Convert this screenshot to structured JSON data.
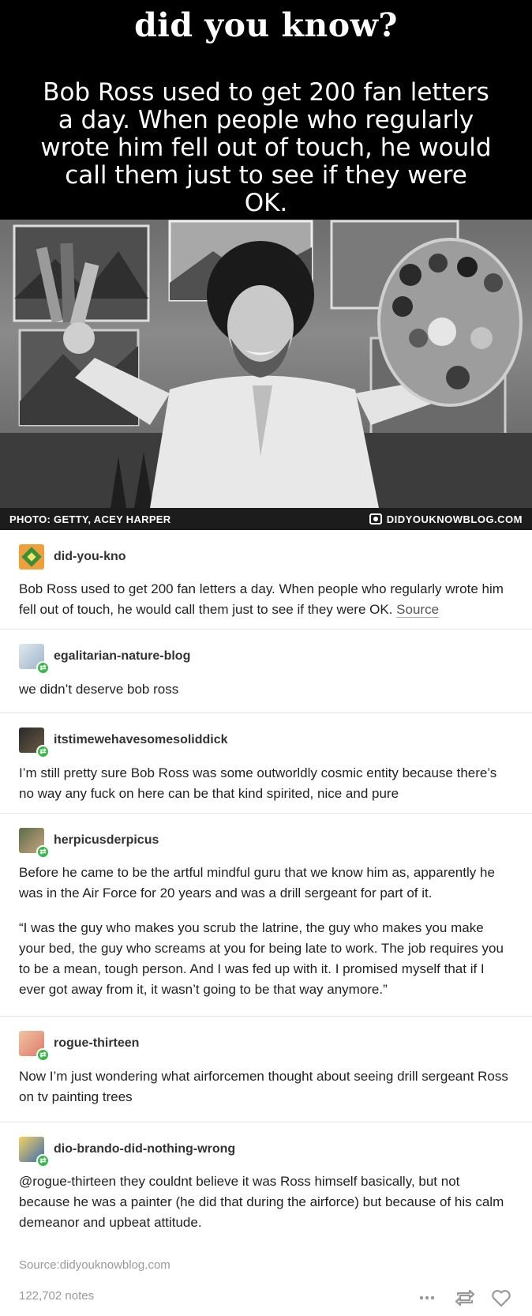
{
  "header": {
    "title": "did you know?",
    "fact": "Bob Ross used to get 200 fan letters a day. When people who regularly wrote him fell out of touch, he would call them just to see if they were OK."
  },
  "photo": {
    "credit": "PHOTO: GETTY, ACEY HARPER",
    "blog": "DIDYOUKNOWBLOG.COM"
  },
  "posts": [
    {
      "username": "did-you-kno",
      "icon": "did-you-know-logo-icon",
      "paragraphs": [
        "Bob Ross used to get 200 fan letters a day. When people who regularly wrote him fell out of touch, he would call them just to see if they were OK."
      ],
      "link": "Source"
    },
    {
      "username": "egalitarian-nature-blog",
      "paragraphs": [
        "we didn’t deserve bob ross"
      ]
    },
    {
      "username": "itstimewehavesomesoliddick",
      "paragraphs": [
        "I’m still pretty sure Bob Ross was some outworldly cosmic entity because there’s no way any fuck on here can be that kind spirited, nice and pure"
      ]
    },
    {
      "username": "herpicusderpicus",
      "paragraphs": [
        "Before he came to be the artful mindful guru that we know him as, apparently he was in the Air Force for 20 years and was a drill sergeant for part of it.",
        "“I was the guy who makes you scrub the latrine, the guy who makes you make your bed, the guy who screams at you for being late to work. The job requires you to be a mean, tough person. And I was fed up with it. I promised myself that if I ever got away from it, it wasn’t going to be that way anymore.”"
      ]
    },
    {
      "username": "rogue-thirteen",
      "paragraphs": [
        "Now I’m just wondering what airforcemen thought about seeing drill sergeant Ross on tv painting trees"
      ]
    },
    {
      "username": "dio-brando-did-nothing-wrong",
      "paragraphs": [
        "@rogue-thirteen they couldnt believe it was Ross himself basically, but not because he was a painter (he did that during the airforce) but because of his calm demeanor and upbeat attitude."
      ]
    }
  ],
  "footer": {
    "source": "Source:didyouknowblog.com",
    "notes": "122,702 notes",
    "icons": [
      "more-options-icon",
      "reblog-icon",
      "like-heart-icon"
    ]
  },
  "colors": {
    "reblog_badge": "#36b848",
    "muted_text": "#999999",
    "header_bg": "#000000"
  }
}
